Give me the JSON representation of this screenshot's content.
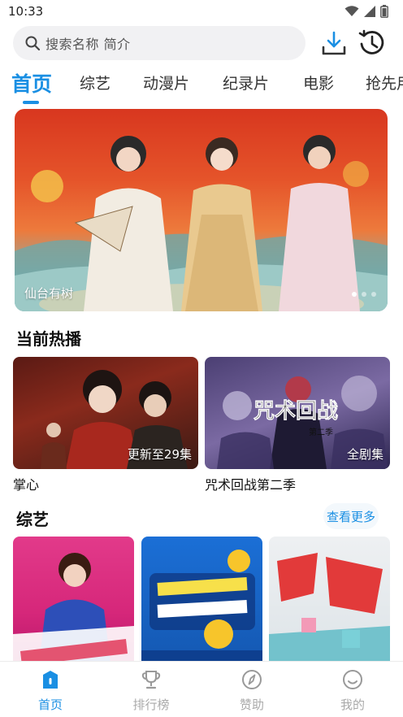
{
  "status_bar": {
    "time": "10:33"
  },
  "search": {
    "placeholder": "搜索名称 简介"
  },
  "tabs": [
    {
      "label": "首页"
    },
    {
      "label": "综艺"
    },
    {
      "label": "动漫片"
    },
    {
      "label": "纪录片"
    },
    {
      "label": "电影"
    },
    {
      "label": "抢先用"
    }
  ],
  "banner": {
    "caption": "仙台有树",
    "active_dot": 1,
    "dot_count": 3
  },
  "hot_section": {
    "title": "当前热播",
    "items": [
      {
        "title": "掌心",
        "badge": "更新至29集"
      },
      {
        "title": "咒术回战第二季",
        "badge": "全剧集"
      }
    ]
  },
  "variety_section": {
    "title": "综艺",
    "more_label": "查看更多"
  },
  "bottom_nav": [
    {
      "label": "首页",
      "icon": "home-icon",
      "active": true
    },
    {
      "label": "排行榜",
      "icon": "trophy-icon",
      "active": false
    },
    {
      "label": "赞助",
      "icon": "compass-icon",
      "active": false
    },
    {
      "label": "我的",
      "icon": "smile-icon",
      "active": false
    }
  ],
  "colors": {
    "accent": "#1a8fe3",
    "inactive_nav": "#aaaaaa"
  }
}
